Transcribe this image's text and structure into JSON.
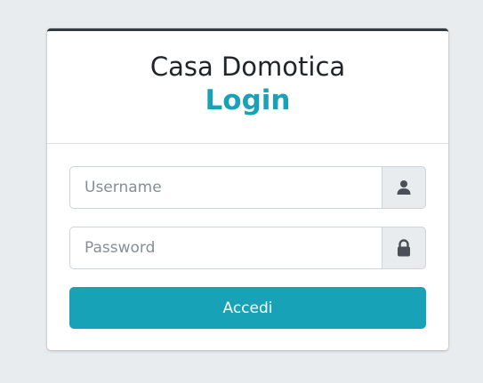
{
  "header": {
    "site_name": "Casa Domotica",
    "page_title": "Login"
  },
  "form": {
    "username": {
      "value": "",
      "placeholder": "Username",
      "icon": "user-icon"
    },
    "password": {
      "value": "",
      "placeholder": "Password",
      "icon": "lock-icon"
    },
    "submit_label": "Accedi"
  },
  "colors": {
    "accent": "#17a2b8",
    "card_top_border": "#343a40",
    "page_background": "#e9ecef"
  }
}
